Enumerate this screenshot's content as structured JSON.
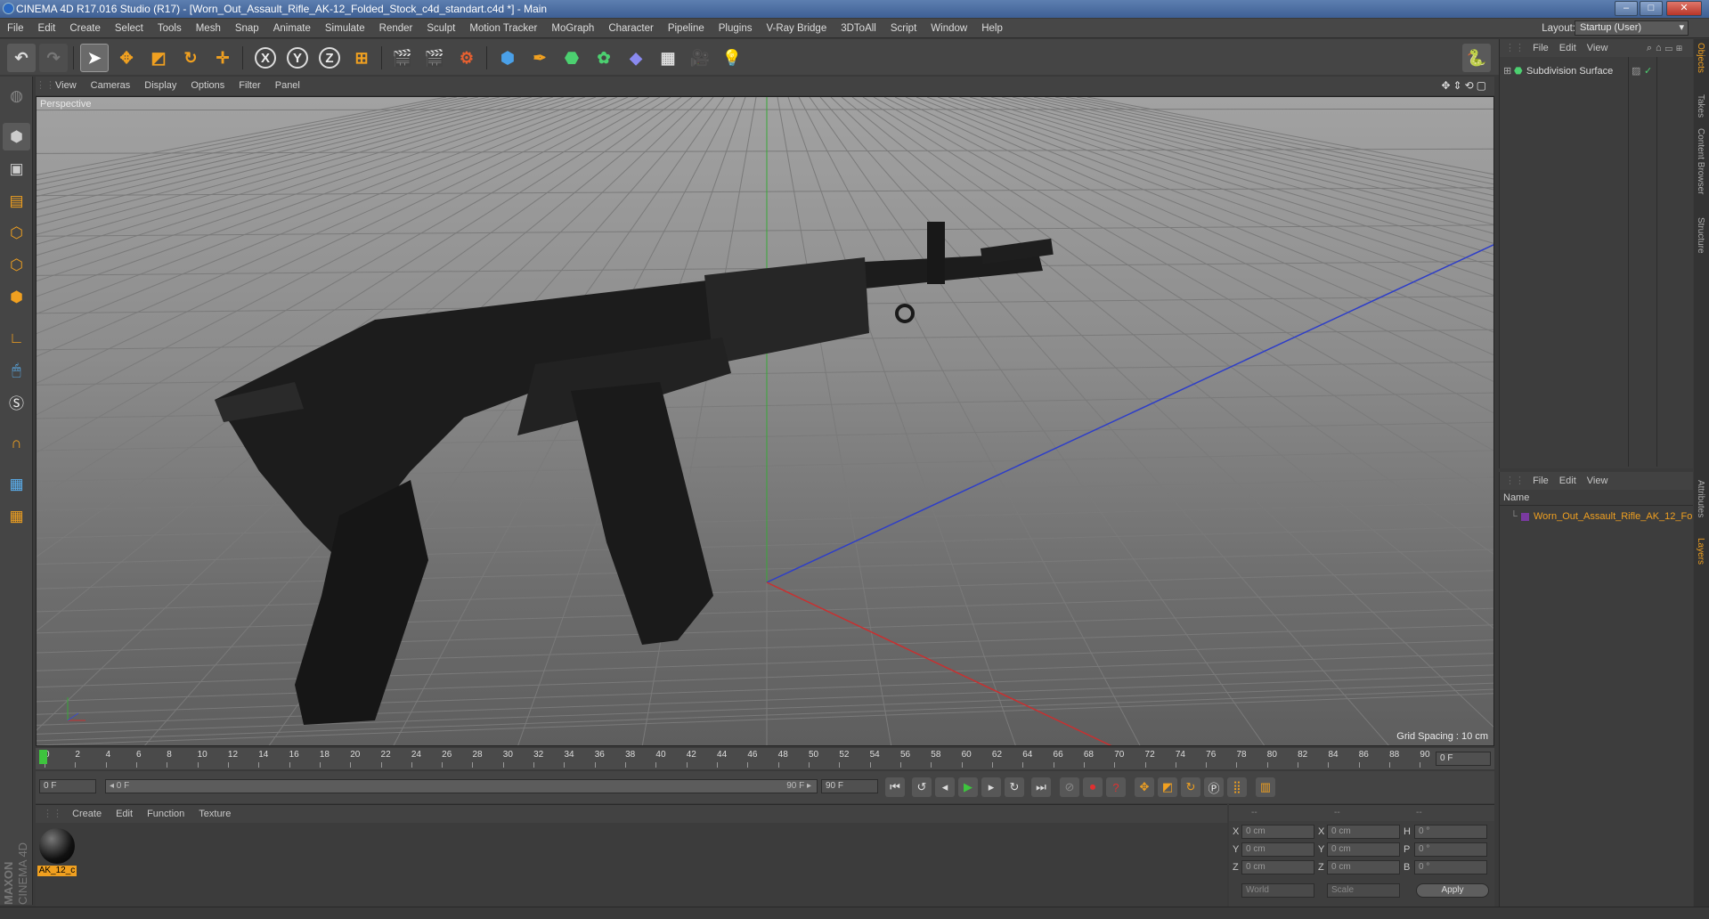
{
  "window": {
    "title": "CINEMA 4D R17.016 Studio (R17) - [Worn_Out_Assault_Rifle_AK-12_Folded_Stock_c4d_standart.c4d *] - Main",
    "minimize": "–",
    "maximize": "□",
    "close": "✕"
  },
  "menu": [
    "File",
    "Edit",
    "Create",
    "Select",
    "Tools",
    "Mesh",
    "Snap",
    "Animate",
    "Simulate",
    "Render",
    "Sculpt",
    "Motion Tracker",
    "MoGraph",
    "Character",
    "Pipeline",
    "Plugins",
    "V-Ray Bridge",
    "3DToAll",
    "Script",
    "Window",
    "Help"
  ],
  "layout": {
    "label": "Layout:",
    "value": "Startup (User)"
  },
  "toolbar": {
    "x_label": "X",
    "y_label": "Y",
    "z_label": "Z"
  },
  "viewport": {
    "menu": [
      "View",
      "Cameras",
      "Display",
      "Options",
      "Filter",
      "Panel"
    ],
    "camera": "Perspective",
    "grid_spacing": "Grid Spacing : 10 cm"
  },
  "timeline": {
    "ticks": [
      "0",
      "2",
      "4",
      "6",
      "8",
      "10",
      "12",
      "14",
      "16",
      "18",
      "20",
      "22",
      "24",
      "26",
      "28",
      "30",
      "32",
      "34",
      "36",
      "38",
      "40",
      "42",
      "44",
      "46",
      "48",
      "50",
      "52",
      "54",
      "56",
      "58",
      "60",
      "62",
      "64",
      "66",
      "68",
      "70",
      "72",
      "74",
      "76",
      "78",
      "80",
      "82",
      "84",
      "86",
      "88",
      "90"
    ],
    "current": "0 F"
  },
  "timecontrols": {
    "start": "0 F",
    "range_start": "◂ 0 F",
    "range_end": "90 F ▸",
    "end": "90 F"
  },
  "materials": {
    "menu": [
      "Create",
      "Edit",
      "Function",
      "Texture"
    ],
    "items": [
      {
        "name": "AK_12_c"
      }
    ]
  },
  "coords": {
    "headers": [
      "--",
      "--",
      "--"
    ],
    "rows": [
      {
        "a": "X",
        "av": "0 cm",
        "b": "X",
        "bv": "0 cm",
        "c": "H",
        "cv": "0 °"
      },
      {
        "a": "Y",
        "av": "0 cm",
        "b": "Y",
        "bv": "0 cm",
        "c": "P",
        "cv": "0 °"
      },
      {
        "a": "Z",
        "av": "0 cm",
        "b": "Z",
        "bv": "0 cm",
        "c": "B",
        "cv": "0 °"
      }
    ],
    "world": "World",
    "scale": "Scale",
    "apply": "Apply"
  },
  "objects": {
    "menu": [
      "File",
      "Edit",
      "View"
    ],
    "items": [
      {
        "name": "Subdivision Surface"
      }
    ]
  },
  "layers": {
    "menu": [
      "File",
      "Edit",
      "View"
    ],
    "column": "Name",
    "items": [
      {
        "name": "Worn_Out_Assault_Rifle_AK_12_Fo"
      }
    ]
  },
  "sidetabs": [
    "Objects",
    "Takes",
    "Content Browser",
    "Structure",
    "Attributes",
    "Layers"
  ],
  "branding": {
    "maxon": "MAXON",
    "cinema": "CINEMA 4D"
  },
  "colors": {
    "accent_orange": "#f0a020",
    "axis_x": "#c83030",
    "axis_y": "#30a030",
    "axis_z": "#3040c0",
    "layer_text": "#f0a020"
  }
}
